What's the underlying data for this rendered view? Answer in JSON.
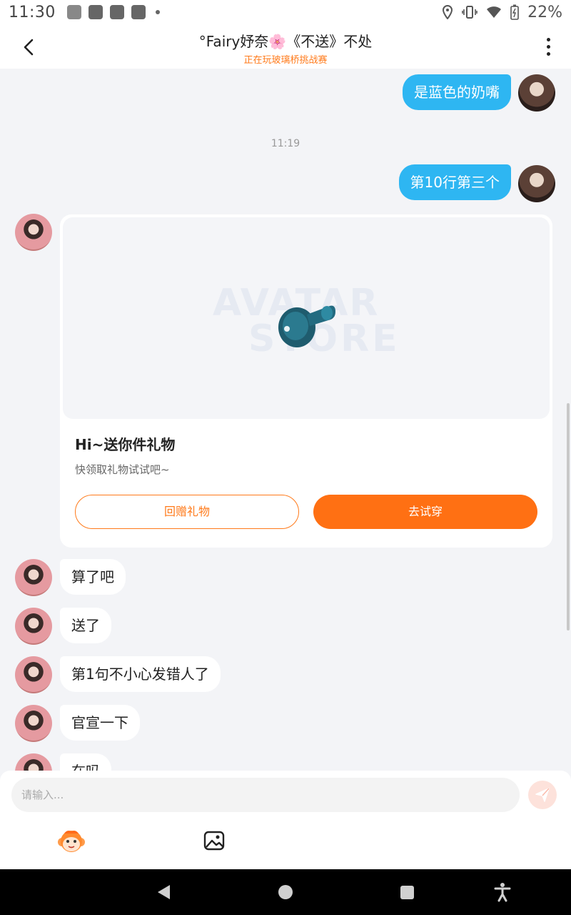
{
  "status_bar": {
    "time": "11:30",
    "battery": "22%",
    "icons": [
      "app-notification-icon",
      "app-icon",
      "app-icon-2",
      "app-icon-3",
      "dot-icon",
      "location-icon",
      "vibrate-icon",
      "wifi-icon",
      "battery-icon"
    ]
  },
  "header": {
    "title": "°Fairy妤奈🌸《不送》不处",
    "subtitle": "正在玩玻璃桥挑战赛",
    "subtitle_color": "#ff7a1a"
  },
  "messages": {
    "out_1": "是蓝色的奶嘴",
    "time_sep": "11:19",
    "out_2": "第10行第三个",
    "in_1": "算了吧",
    "in_2": "送了",
    "in_3": "第1句不小心发错人了",
    "in_4": "官宣一下",
    "in_5_partial": "在吗"
  },
  "gift_card": {
    "watermark_line1": "AVATAR",
    "watermark_line2": "STORE",
    "title": "Hi~送你件礼物",
    "description": "快领取礼物试试吧~",
    "return_gift_label": "回赠礼物",
    "try_on_label": "去试穿",
    "accent_color": "#ff7013"
  },
  "input": {
    "placeholder": "请输入..."
  },
  "colors": {
    "outgoing_bubble": "#2eb6f2",
    "chat_background": "#f3f4f7"
  }
}
